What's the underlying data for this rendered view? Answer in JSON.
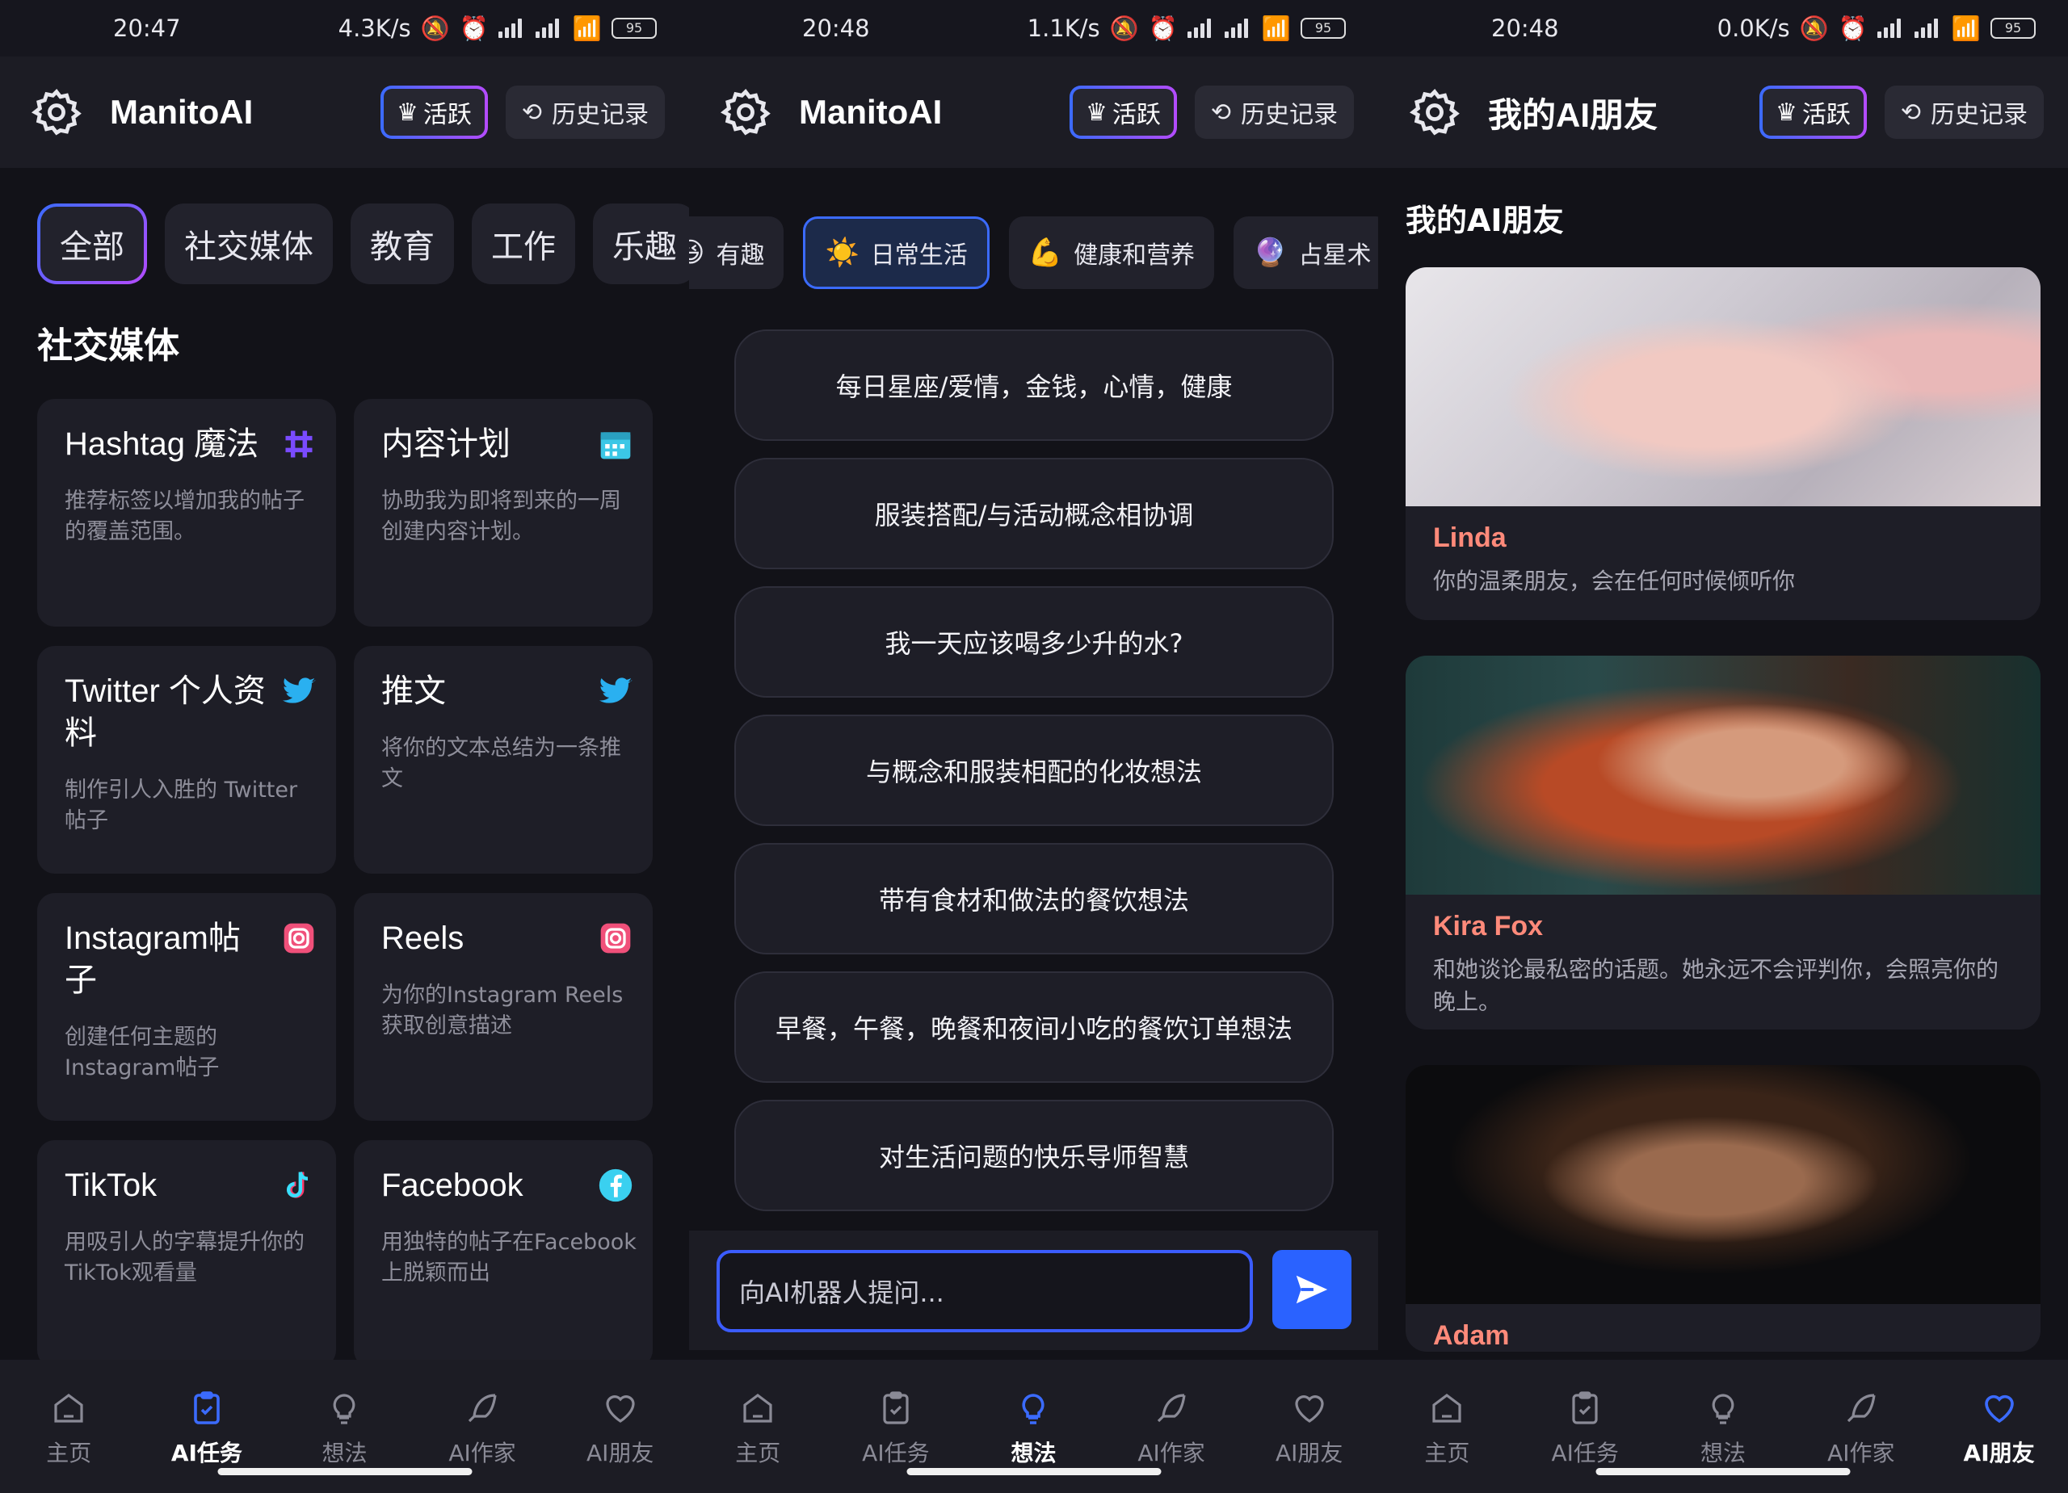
{
  "screens": {
    "s1": {
      "time": "20:47",
      "net": "4.3K/s",
      "battery": "95",
      "app_title": "ManitoAI",
      "active_label": "活跃",
      "history_label": "历史记录",
      "categories": [
        "全部",
        "社交媒体",
        "教育",
        "工作",
        "乐趣"
      ],
      "section_title": "社交媒体",
      "cards": [
        {
          "title": "Hashtag 魔法",
          "desc": "推荐标签以增加我的帖子的覆盖范围。",
          "icon": "hashtag-icon"
        },
        {
          "title": "内容计划",
          "desc": "协助我为即将到来的一周创建内容计划。",
          "icon": "calendar-icon"
        },
        {
          "title": "Twitter 个人资料",
          "desc": "制作引人入胜的 Twitter 帖子",
          "icon": "twitter-icon"
        },
        {
          "title": "推文",
          "desc": "将你的文本总结为一条推文",
          "icon": "twitter-icon"
        },
        {
          "title": "Instagram帖子",
          "desc": "创建任何主题的Instagram帖子",
          "icon": "instagram-icon"
        },
        {
          "title": "Reels",
          "desc": "为你的Instagram Reels获取创意描述",
          "icon": "instagram-icon"
        },
        {
          "title": "TikTok",
          "desc": "用吸引人的字幕提升你的TikTok观看量",
          "icon": "tiktok-icon"
        },
        {
          "title": "Facebook",
          "desc": "用独特的帖子在Facebook上脱颖而出",
          "icon": "facebook-icon"
        }
      ]
    },
    "s2": {
      "time": "20:48",
      "net": "1.1K/s",
      "battery": "95",
      "app_title": "ManitoAI",
      "active_label": "活跃",
      "history_label": "历史记录",
      "chips": [
        {
          "emoji": "😆",
          "label": "有趣"
        },
        {
          "emoji": "☀️",
          "label": "日常生活"
        },
        {
          "emoji": "💪",
          "label": "健康和营养"
        },
        {
          "emoji": "🔮",
          "label": "占星术"
        }
      ],
      "ideas": [
        "每日星座/爱情，金钱，心情，健康",
        "服装搭配/与活动概念相协调",
        "我一天应该喝多少升的水?",
        "与概念和服装相配的化妆想法",
        "带有食材和做法的餐饮想法",
        "早餐，午餐，晚餐和夜间小吃的餐饮订单想法",
        "对生活问题的快乐导师智慧"
      ],
      "input_placeholder": "向AI机器人提问..."
    },
    "s3": {
      "time": "20:48",
      "net": "0.0K/s",
      "battery": "95",
      "app_title": "我的AI朋友",
      "active_label": "活跃",
      "history_label": "历史记录",
      "list_title": "我的AI朋友",
      "friends": [
        {
          "name": "Linda",
          "desc": "你的温柔朋友，会在任何时候倾听你"
        },
        {
          "name": "Kira Fox",
          "desc": "和她谈论最私密的话题。她永远不会评判你，会照亮你的晚上。"
        },
        {
          "name": "Adam",
          "desc": ""
        }
      ]
    }
  },
  "nav": [
    "主页",
    "AI任务",
    "想法",
    "AI作家",
    "AI朋友"
  ],
  "colors": {
    "accent": "#3b6bff",
    "gradient_end": "#b44bff",
    "bg": "#121218",
    "card": "#1e1e27",
    "friend_name": "#ff8a7a"
  }
}
